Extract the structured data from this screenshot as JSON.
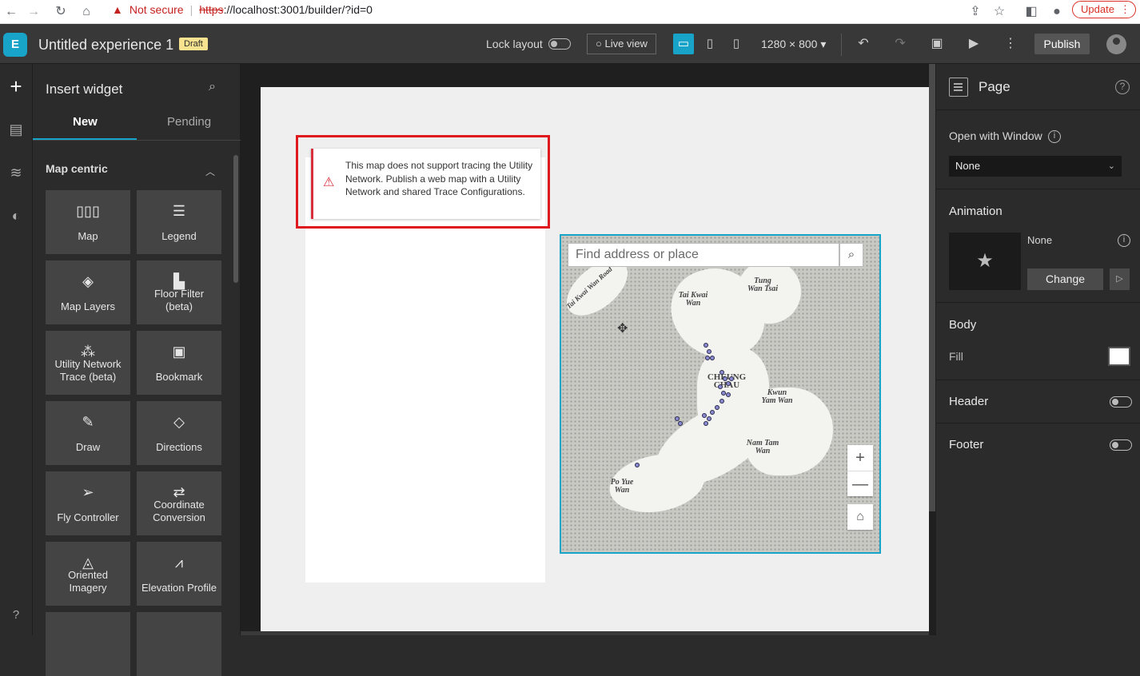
{
  "browser": {
    "security_label": "Not secure",
    "url_scheme": "https",
    "url_rest": "://localhost:3001/builder/?id=0",
    "update_label": "Update"
  },
  "app": {
    "title": "Untitled experience 1",
    "status_badge": "Draft",
    "lock_layout_label": "Lock layout",
    "live_view_label": "Live view",
    "resolution": "1280 × 800",
    "publish_label": "Publish"
  },
  "insert_panel": {
    "title": "Insert widget",
    "tabs": [
      {
        "label": "New"
      },
      {
        "label": "Pending"
      }
    ],
    "category": "Map centric",
    "widgets": [
      {
        "label": "Map",
        "icon": "map-icon"
      },
      {
        "label": "Legend",
        "icon": "legend-icon"
      },
      {
        "label": "Map Layers",
        "icon": "layers-icon"
      },
      {
        "label": "Floor Filter (beta)",
        "icon": "floor-filter-icon"
      },
      {
        "label": "Utility Network Trace (beta)",
        "icon": "utility-network-icon"
      },
      {
        "label": "Bookmark",
        "icon": "bookmark-icon"
      },
      {
        "label": "Draw",
        "icon": "draw-icon"
      },
      {
        "label": "Directions",
        "icon": "directions-icon"
      },
      {
        "label": "Fly Controller",
        "icon": "fly-controller-icon"
      },
      {
        "label": "Coordinate Conversion",
        "icon": "coordinate-conversion-icon"
      },
      {
        "label": "Oriented Imagery",
        "icon": "oriented-imagery-icon"
      },
      {
        "label": "Elevation Profile",
        "icon": "elevation-profile-icon"
      }
    ]
  },
  "canvas": {
    "alert_message": "This map does not support tracing the Utility Network. Publish a web map with a Utility Network and shared Trace Configurations.",
    "map_search_placeholder": "Find address or place",
    "map_places": [
      {
        "name": "Tai Kwai Wan"
      },
      {
        "name": "Tung Wan Tsai"
      },
      {
        "name": "Kwun Yam Wan"
      },
      {
        "name": "Nam Tam Wan"
      },
      {
        "name": "Po Yue Wan"
      },
      {
        "name": "CHEUNG CHAU"
      },
      {
        "name": "Tai Kwai Wan Road"
      }
    ]
  },
  "properties": {
    "title": "Page",
    "open_with_window_label": "Open with Window",
    "open_with_window_value": "None",
    "animation_label": "Animation",
    "animation_value": "None",
    "change_label": "Change",
    "body_label": "Body",
    "fill_label": "Fill",
    "fill_color": "#ffffff",
    "header_label": "Header",
    "footer_label": "Footer"
  },
  "colors": {
    "accent": "#18a3c9",
    "alert_red": "#e0191f"
  }
}
